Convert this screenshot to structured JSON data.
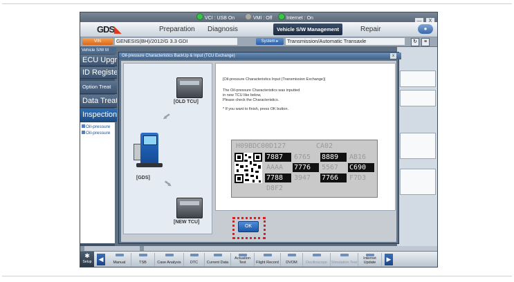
{
  "status_bar": {
    "vci": "VCI : USB On",
    "vmi": "VMI : Off",
    "internet": "Internet : On",
    "minimize": "—",
    "close": "X"
  },
  "menu": {
    "logo": "GDS",
    "items": [
      {
        "label": "Preparation",
        "active": false
      },
      {
        "label": "Diagnosis",
        "active": false
      },
      {
        "label": "Vehicle S/W Management",
        "active": true
      },
      {
        "label": "Repair",
        "active": false
      }
    ]
  },
  "vehicle_bar": {
    "vin_button": "VIN",
    "vehicle": "GENESIS(BH)/2012/G 3.3 GDI",
    "system_button": "System ▸",
    "system": "Transmission/Automatic Transaxle"
  },
  "left_panel": {
    "header": "Vehicle S/W M",
    "items": [
      "ECU Upgr",
      "ID Registe",
      "Option Treat",
      "Data Treatr",
      "Inspection /"
    ],
    "sub_items": [
      "Oil-pressure",
      "Oil-pressure"
    ]
  },
  "dialog": {
    "title": "Oil-pressure Characteristics BackUp & Input (TCU Exchange)",
    "close": "x",
    "old_tcu": "[OLD TCU]",
    "gds": "[GDS]",
    "new_tcu": "[NEW TCU]",
    "message": [
      "[Oil-pressure Characteristics Input (Transmission Exchange)]",
      "The Oil-pressure Characteristics was inputted",
      "in new TCU like below,",
      "Please check the Characteristics.",
      "* If you want to finish, press OK button."
    ],
    "codes": {
      "row1": [
        "H09BDC00D127",
        "CA02"
      ],
      "row2": [
        "7887",
        "6765",
        "8889",
        "AB16"
      ],
      "row3": [
        "AAAA",
        "7776",
        "5567",
        "C690"
      ],
      "row4": [
        "7788",
        "3947",
        "7766",
        "F7D3"
      ],
      "row5": [
        "D8F2"
      ]
    },
    "ok": "OK"
  },
  "toolbar": {
    "setup": "Setup",
    "buttons": [
      {
        "label": "Manual",
        "dim": false
      },
      {
        "label": "TSB",
        "dim": false
      },
      {
        "label": "Case Analysis",
        "dim": false
      },
      {
        "label": "DTC",
        "dim": false
      },
      {
        "label": "Current Data",
        "dim": false
      },
      {
        "label": "Actuation Test",
        "dim": false
      },
      {
        "label": "Flight Record",
        "dim": false
      },
      {
        "label": "DVOM",
        "dim": false
      },
      {
        "label": "Oscilloscope",
        "dim": true
      },
      {
        "label": "Simulation Test",
        "dim": true
      },
      {
        "label": "Internet Update",
        "dim": false
      }
    ]
  },
  "colors": {
    "accent": "#1d56a6",
    "highlight": "#e11b1b",
    "status_on": "#3cc24a"
  }
}
